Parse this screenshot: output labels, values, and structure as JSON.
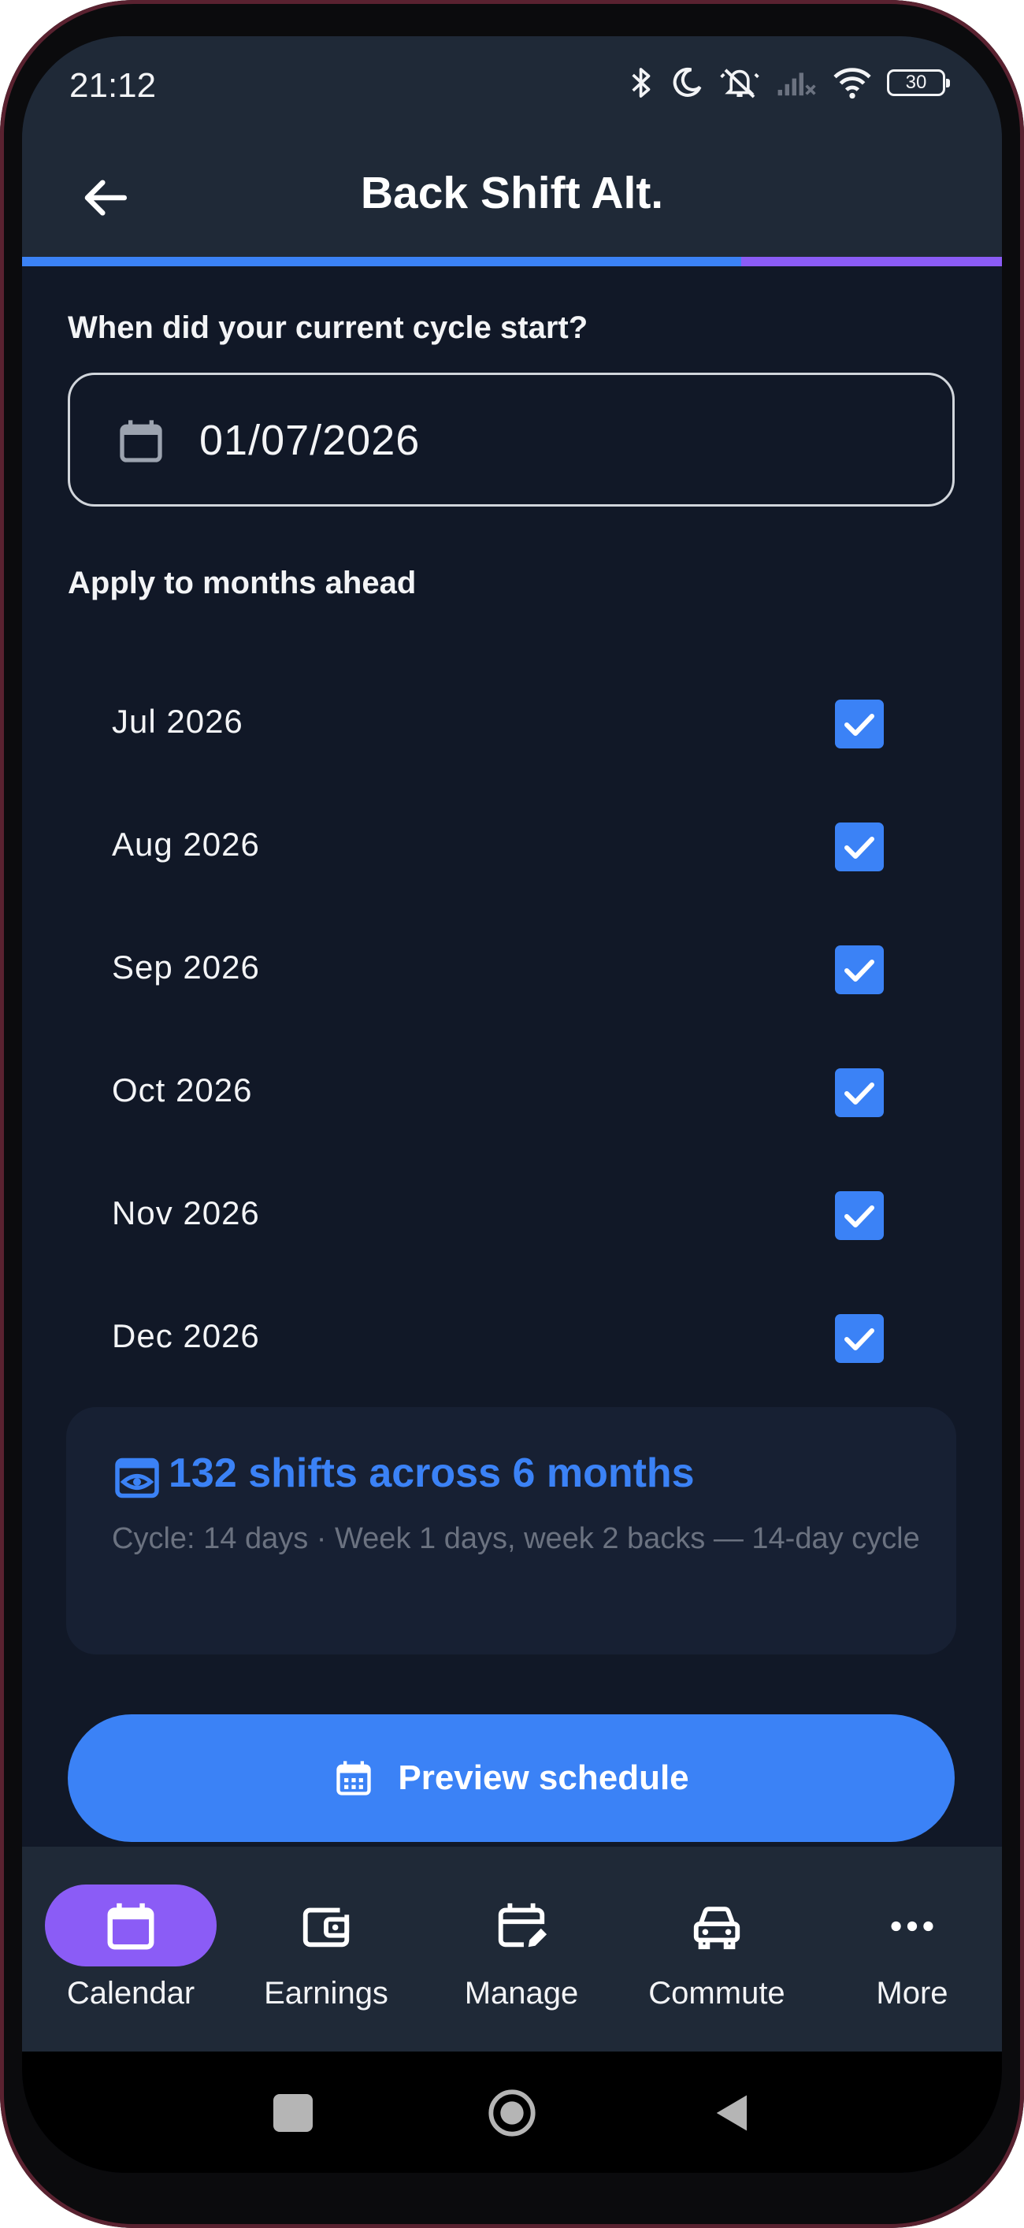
{
  "status_bar": {
    "time": "21:12",
    "battery": "30",
    "icons": [
      "bluetooth-icon",
      "do-not-disturb-moon-icon",
      "mute-icon",
      "signal-icon",
      "wifi-icon",
      "battery-icon"
    ]
  },
  "app_bar": {
    "title": "Back Shift Alt.",
    "back_icon": "arrow-left-icon"
  },
  "progress": {
    "fraction": 0.734,
    "colors": {
      "primary": "#3b82f6",
      "secondary": "#8b5cf6"
    }
  },
  "cycle_start": {
    "question": "When did your current cycle start?",
    "date_value": "01/07/2026",
    "icon": "calendar-icon"
  },
  "months": {
    "label": "Apply to months ahead",
    "items": [
      {
        "label": "Jul 2026",
        "checked": true
      },
      {
        "label": "Aug 2026",
        "checked": true
      },
      {
        "label": "Sep 2026",
        "checked": true
      },
      {
        "label": "Oct 2026",
        "checked": true
      },
      {
        "label": "Nov 2026",
        "checked": true
      },
      {
        "label": "Dec 2026",
        "checked": true
      }
    ]
  },
  "summary": {
    "icon": "eye-icon",
    "headline": "132 shifts across 6 months",
    "detail": "Cycle: 14 days · Week 1 days, week 2 backs — 14-day cycle"
  },
  "preview_button": {
    "label": "Preview schedule",
    "icon": "calendar-grid-icon"
  },
  "bottom_nav": {
    "items": [
      {
        "label": "Calendar",
        "icon": "calendar-icon",
        "active": true
      },
      {
        "label": "Earnings",
        "icon": "wallet-icon",
        "active": false
      },
      {
        "label": "Manage",
        "icon": "calendar-edit-icon",
        "active": false
      },
      {
        "label": "Commute",
        "icon": "car-icon",
        "active": false
      },
      {
        "label": "More",
        "icon": "more-dots-icon",
        "active": false
      }
    ]
  },
  "system_nav": {
    "icons": [
      "recents-square-icon",
      "home-circle-icon",
      "back-triangle-icon"
    ]
  },
  "colors": {
    "background": "#111827",
    "surface": "#1f2937",
    "accent_blue": "#3b82f6",
    "accent_purple": "#8b5cf6",
    "muted_text": "#6b7280"
  }
}
